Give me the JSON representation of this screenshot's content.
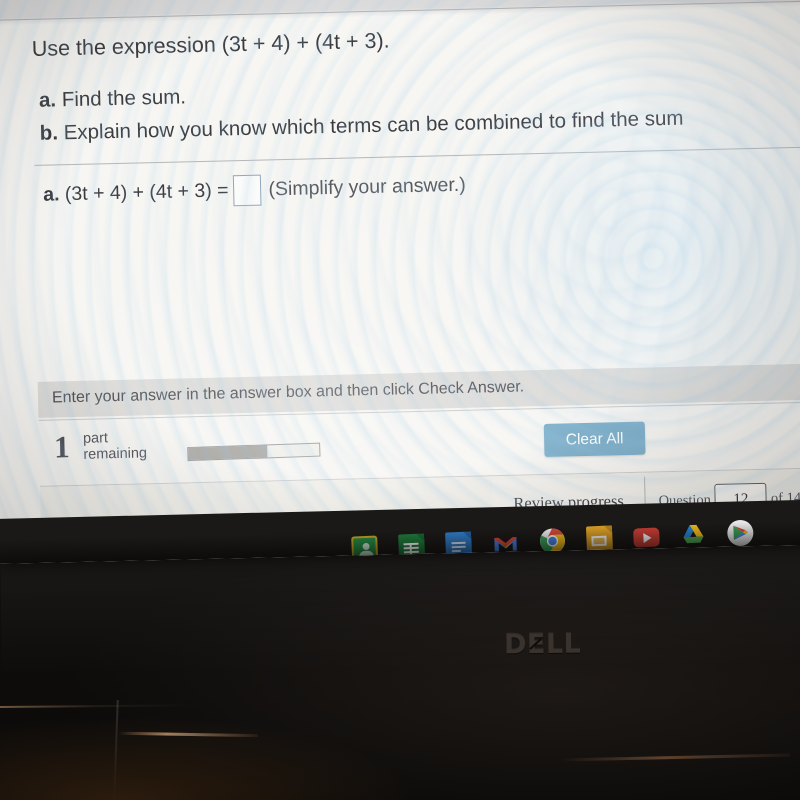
{
  "screen": {
    "question": {
      "prompt": "Use the expression (3t + 4) + (4t + 3).",
      "part_a_label": "a.",
      "part_a_text": "Find the sum.",
      "part_b_label": "b.",
      "part_b_text": "Explain how you know which terms can be combined to find the sum",
      "answer_label": "a.",
      "answer_expression": "(3t + 4) + (4t + 3) =",
      "answer_value": "",
      "answer_hint": "(Simplify your answer.)"
    },
    "instruction": "Enter your answer in the answer box and then click Check Answer.",
    "footer": {
      "parts_remaining_count": "1",
      "parts_remaining_line1": "part",
      "parts_remaining_line2": "remaining",
      "progress_percent": 60,
      "clear_all_label": "Clear All"
    },
    "nav": {
      "review_progress_label": "Review progress",
      "question_label": "Question",
      "question_number": "12",
      "of_label": "of 14"
    },
    "shelf": {
      "icons": [
        {
          "name": "google-classroom-icon",
          "label": "Classroom",
          "active": true
        },
        {
          "name": "google-sheets-icon",
          "label": "Sheets",
          "active": false
        },
        {
          "name": "google-docs-icon",
          "label": "Docs",
          "active": false
        },
        {
          "name": "gmail-icon",
          "label": "Gmail",
          "active": false
        },
        {
          "name": "google-chrome-icon",
          "label": "Chrome",
          "active": true
        },
        {
          "name": "google-slides-icon",
          "label": "Slides",
          "active": false
        },
        {
          "name": "youtube-icon",
          "label": "YouTube",
          "active": false
        },
        {
          "name": "google-drive-icon",
          "label": "Drive",
          "active": false
        },
        {
          "name": "google-play-store-icon",
          "label": "Play Store",
          "active": false
        }
      ]
    }
  },
  "hardware": {
    "brand_logo": "DELL",
    "brand_logo_part1": "D",
    "brand_logo_part2": "E",
    "brand_logo_part3": "LL"
  },
  "colors": {
    "clear_all_button": "#7fb0cb",
    "answer_box_border": "#8fa6bb",
    "page_background": "#f7f6f3",
    "text": "#3a3c42",
    "bezel": "#1b1917"
  }
}
